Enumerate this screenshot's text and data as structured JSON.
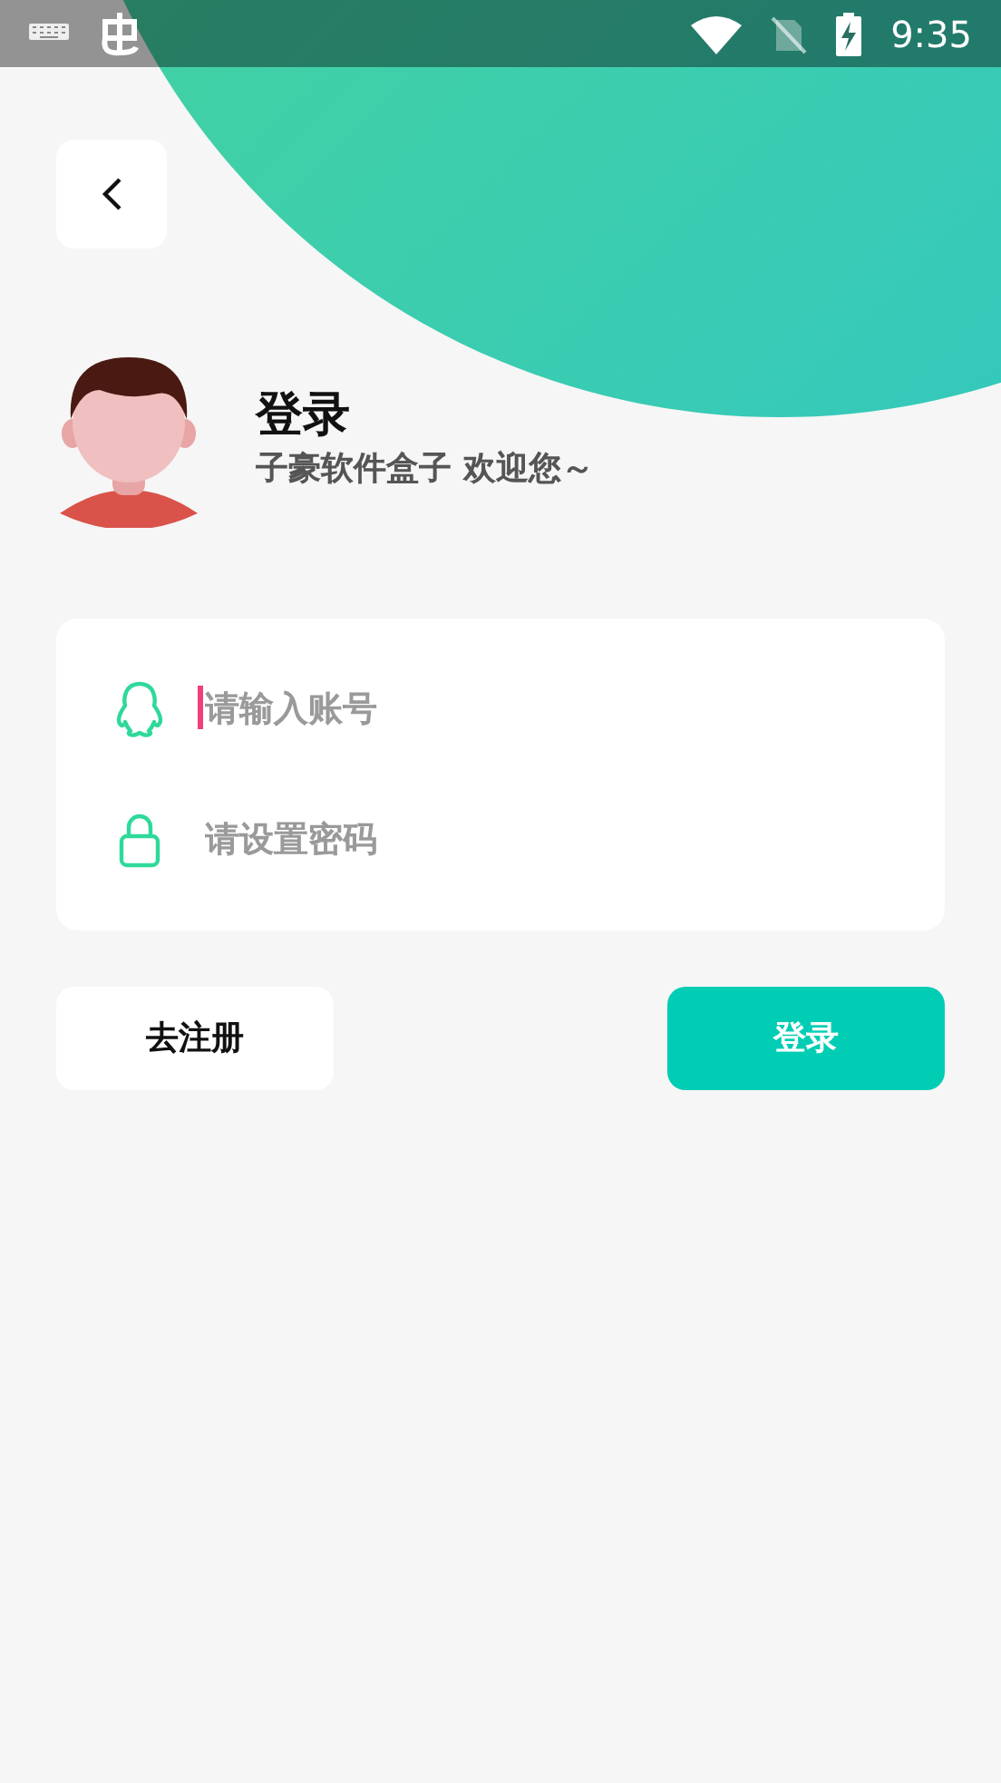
{
  "status_bar": {
    "time": "9:35"
  },
  "header": {
    "title": "登录",
    "subtitle": "子豪软件盒子 欢迎您～"
  },
  "form": {
    "fields": [
      {
        "kind": "account",
        "placeholder": "请输入账号",
        "focused": true
      },
      {
        "kind": "password",
        "placeholder": "请设置密码",
        "focused": false
      }
    ]
  },
  "buttons": [
    {
      "kind": "secondary",
      "label": "去注册"
    },
    {
      "kind": "primary",
      "label": "登录"
    }
  ]
}
